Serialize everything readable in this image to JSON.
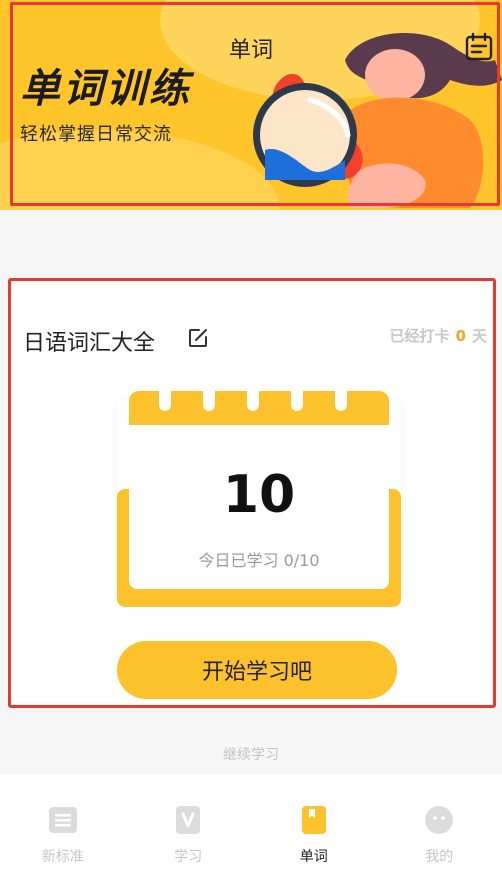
{
  "header": {
    "title": "单词",
    "headline": "单词训练",
    "subline": "轻松掌握日常交流"
  },
  "card": {
    "book_name": "日语词汇大全",
    "streak_prefix": "已经打卡",
    "streak_count": "0",
    "streak_suffix": "天",
    "today_count": "10",
    "today_progress": "今日已学习 0/10",
    "start_button": "开始学习吧"
  },
  "continue_label": "继续学习",
  "tabs": [
    {
      "label": "新标准",
      "icon": "book-stack-icon",
      "active": false
    },
    {
      "label": "学习",
      "icon": "v-card-icon",
      "active": false
    },
    {
      "label": "单词",
      "icon": "bookmark-book-icon",
      "active": true
    },
    {
      "label": "我的",
      "icon": "face-icon",
      "active": false
    }
  ],
  "colors": {
    "accent": "#fcc12b",
    "streak_number": "#f5a623",
    "annotation_border": "#e53935"
  }
}
